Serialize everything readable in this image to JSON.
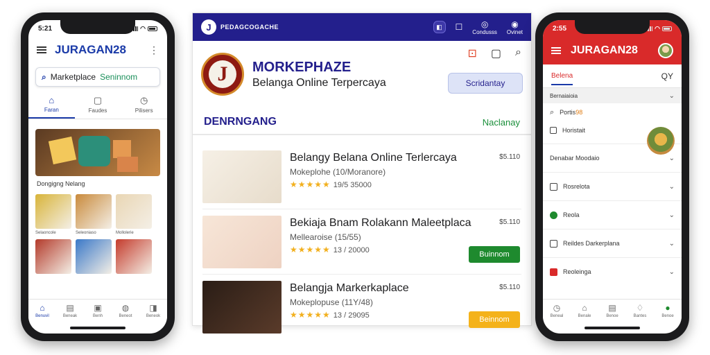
{
  "left_phone": {
    "time": "5:21",
    "brand": "JURAGAN28",
    "search": {
      "text": "Marketplace",
      "hint": "Seninnom"
    },
    "tabs": [
      {
        "icon": "home-icon",
        "label": "Faran"
      },
      {
        "icon": "chat-icon",
        "label": "Faudes"
      },
      {
        "icon": "clock-icon",
        "label": "Pilisers"
      }
    ],
    "banner_caption": "Dongigng  Nelang",
    "grid": [
      {
        "label": "Selaoncole",
        "color": "#d8b43a"
      },
      {
        "label": "Seleoniaso",
        "color": "#c98a3c"
      },
      {
        "label": "Mollolerie",
        "color": "#e9d6b4"
      },
      {
        "label": "",
        "color": "#b33a2a"
      },
      {
        "label": "",
        "color": "#3a78c8"
      },
      {
        "label": "",
        "color": "#c43b2c"
      }
    ],
    "nav": [
      "Benuvil",
      "Beneak",
      "Benh",
      "Beneot",
      "Beneok"
    ]
  },
  "desk": {
    "top_brand": "PEDAGCOGACHE",
    "top_icons": [
      {
        "glyph": "☐",
        "label": ""
      },
      {
        "glyph": "◎",
        "label": "Condusss"
      },
      {
        "glyph": "◉",
        "label": "Ovinet"
      }
    ],
    "title": "MORKEPHAZE",
    "subtitle": "Belanga Online Terpercaya",
    "cta": "Scridantay",
    "section": "DENRNGANG",
    "section_link": "Naclanay",
    "items": [
      {
        "name": "Belangy Belana Online Terlercaya",
        "meta": "Mokeplohe    (10/Moranore)",
        "stars": "★★★★★",
        "count": "19/5  35000",
        "price": "$5.110",
        "buy": "",
        "buy_color": "",
        "img": "box"
      },
      {
        "name": "Bekiaja Bnam Rolakann Maleetplaca",
        "meta": "Mellearoise    (15/55)",
        "stars": "★★★★★",
        "count": "13  /  20000",
        "price": "$5.110",
        "buy": "Buinnom",
        "buy_color": "#1e8a2e",
        "img": "bottle"
      },
      {
        "name": "Belangja Markerkaplace",
        "meta": "Mokeplopuse    (11Y/48)",
        "stars": "★★★★★",
        "count": "13  /  29095",
        "price": "$5.110",
        "buy": "Beinnom",
        "buy_color": "#f4b21a",
        "img": "cake"
      }
    ]
  },
  "right_phone": {
    "time": "2:55",
    "brand": "JURAGAN28",
    "tab": "Belena",
    "search_icon": "QY",
    "sub": "Bernaiaioia",
    "checks": [
      {
        "label": "Portis",
        "badge": "98"
      },
      {
        "label": "Horistait",
        "badge": ""
      }
    ],
    "rows": [
      {
        "label": "Denabar Moodaio",
        "icon": "none",
        "color": ""
      },
      {
        "label": "Rosrelota",
        "icon": "square",
        "color": ""
      },
      {
        "label": "Reola",
        "icon": "circle",
        "color": "#1e8a2e"
      },
      {
        "label": "Reildes Darkerplana",
        "icon": "square",
        "color": ""
      },
      {
        "label": "Reoleinga",
        "icon": "shield",
        "color": "#d92a2a"
      }
    ],
    "nav": [
      "Beneal",
      "Benale",
      "Benoe",
      "Bantes",
      "Benoe"
    ]
  }
}
